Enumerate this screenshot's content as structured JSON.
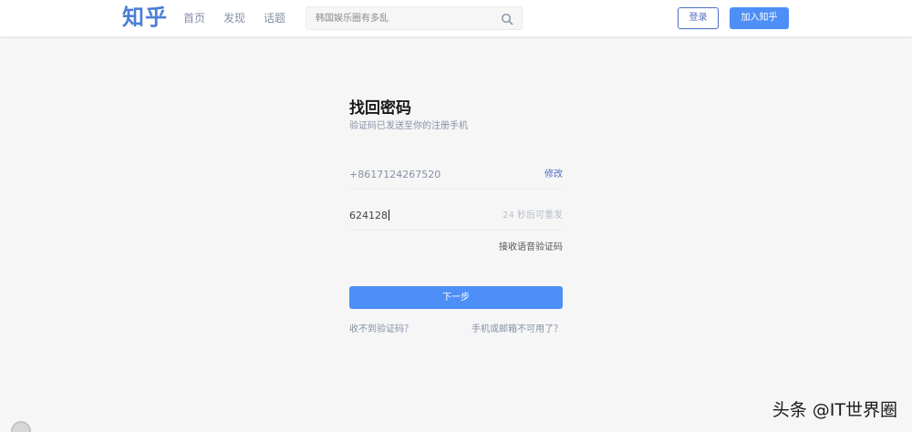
{
  "header": {
    "logo": "知乎",
    "nav": [
      {
        "label": "首页"
      },
      {
        "label": "发现"
      },
      {
        "label": "话题"
      }
    ],
    "search": {
      "placeholder": "韩国娱乐圈有多乱",
      "icon": "search-icon"
    },
    "login_label": "登录",
    "join_label": "加入知乎"
  },
  "form": {
    "title": "找回密码",
    "subtitle": "验证码已发送至你的注册手机",
    "phone": {
      "value": "+8617124267520",
      "action_label": "修改"
    },
    "code": {
      "value": "624128",
      "resend_hint": "24 秒后可重发"
    },
    "voice_code_label": "接收语音验证码",
    "next_label": "下一步",
    "no_code_label": "收不到验证码？",
    "unavailable_label": "手机或邮箱不可用了？"
  },
  "watermark": "头条 @IT世界圈",
  "colors": {
    "brand": "#4e8ef7",
    "logo": "#4a7ed6",
    "muted_text": "#8590a6"
  }
}
